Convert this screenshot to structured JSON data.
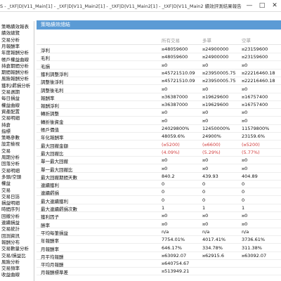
{
  "window": {
    "title": "S - _tXF|D|V11_Main[1] - _tXF|D|V11_Main2[1] - _tXF|D|V11_Main2[1] - _tXF|D|V11_Main2 績效評測結果報告",
    "min_label": "—",
    "max_label": "□",
    "close_label": "✕"
  },
  "sidebar": {
    "items": [
      "策略績效報表",
      "績效總覽",
      "交易分析",
      "月報酬率",
      "年度報酬分析",
      "帳戶權益曲線",
      "持倉期間分析",
      "期間報酬分析",
      "風險報酬分析",
      "獲利/虧損分析",
      "交易週期",
      "每日損益",
      "權益曲線",
      "資產配置",
      "交易明細",
      "持倉",
      "指標",
      "策略參數",
      "設定檢視",
      "交易",
      "周期分析",
      "回落分析",
      "交易明細",
      "多頭/空頭",
      "權益",
      "交易",
      "交易日誌",
      "損益明細",
      "時間序列",
      "回撤分析",
      "連續損益",
      "交易統計",
      "回測資訊",
      "報酬分布",
      "交易數量分析",
      "交易/損益比",
      "風險分析",
      "交易頻率",
      "收益曲線"
    ]
  },
  "panel": {
    "title": "策略績效總結",
    "col_all": "所有交易",
    "col_long": "多單",
    "col_short": "空單",
    "rows": [
      {
        "label": "淨利",
        "all": "¤48059600",
        "long": "¤24900000",
        "short": "¤23159600"
      },
      {
        "label": "毛利",
        "all": "¤48059600",
        "long": "¤24900000",
        "short": "¤23159600"
      },
      {
        "label": "毛損",
        "all": "¤0",
        "long": "¤0",
        "short": "¤0"
      },
      {
        "label": "獲利調整淨利",
        "all": "¤45721510.09",
        "long": "¤23950005.75",
        "short": "¤22216460.18"
      },
      {
        "label": "調整後淨利",
        "all": "¤45721510.09",
        "long": "¤23950005.75",
        "short": "¤22216460.18"
      },
      {
        "label": "調整後毛利",
        "all": "¤0",
        "long": "¤0",
        "short": "¤0"
      },
      {
        "label": "報酬率",
        "all": "¤36387000",
        "long": "¤19629600",
        "short": "¤16757400"
      },
      {
        "label": "報酬淨利",
        "all": "¤36387000",
        "long": "¤19629600",
        "short": "¤16757400"
      },
      {
        "label": "轉折調整",
        "all": "¤0",
        "long": "¤0",
        "short": "¤0"
      },
      {
        "label": "轉折後資金",
        "all": "¤0",
        "long": "¤0",
        "short": "¤0"
      },
      {
        "label": "帳戶價值",
        "all": "24029800%",
        "long": "12450000%",
        "short": "11579800%"
      },
      {
        "label": "年化報酬率",
        "all": "48059.6%",
        "long": "24900%",
        "short": "23159.6%"
      },
      {
        "label": "最大回撤金額",
        "all": "(¤5200)",
        "long": "(¤6600)",
        "short": "(¤5200)",
        "red": true
      },
      {
        "label": "最大回撤比",
        "all": "(4.09%)",
        "long": "(5.29%)",
        "short": "(5.77%)",
        "red": true
      },
      {
        "label": "單一最大回撤",
        "all": "¤0",
        "long": "¤0",
        "short": "¤0"
      },
      {
        "label": "單一最大回撤比",
        "all": "¤0",
        "long": "¤0",
        "short": "¤0"
      },
      {
        "label": "最大回撤期間天數",
        "all": "840.2",
        "long": "439.93",
        "short": "404.89"
      },
      {
        "label": "連續獲利",
        "all": "0",
        "long": "0",
        "short": "0"
      },
      {
        "label": "連續虧損",
        "all": "0",
        "long": "0",
        "short": "0"
      },
      {
        "label": "最大連續獲利",
        "all": "0",
        "long": "0",
        "short": "0"
      },
      {
        "label": "最大連續虧損次數",
        "all": "1",
        "long": "1",
        "short": "1"
      },
      {
        "label": "獲利因子",
        "all": "¤0",
        "long": "¤0",
        "short": "¤0"
      },
      {
        "label": "勝率",
        "all": "¤0",
        "long": "¤0",
        "short": "¤0"
      },
      {
        "label": "平均每筆損益",
        "all": "n/a",
        "long": "n/a",
        "short": "n/a"
      },
      {
        "label": "年報酬率",
        "all": "7754.01%",
        "long": "4017.41%",
        "short": "3736.61%"
      },
      {
        "label": "月報酬率",
        "all": "646.17%",
        "long": "334.78%",
        "short": "311.38%"
      },
      {
        "label": "月平均報酬",
        "all": "¤63092.07",
        "long": "¤62915.6",
        "short": "¤63092.07"
      },
      {
        "label": "平均月報酬",
        "all": "¤640754.67",
        "long": "",
        "short": ""
      },
      {
        "label": "月報酬標準差",
        "all": "¤513949.21",
        "long": "",
        "short": ""
      }
    ]
  }
}
